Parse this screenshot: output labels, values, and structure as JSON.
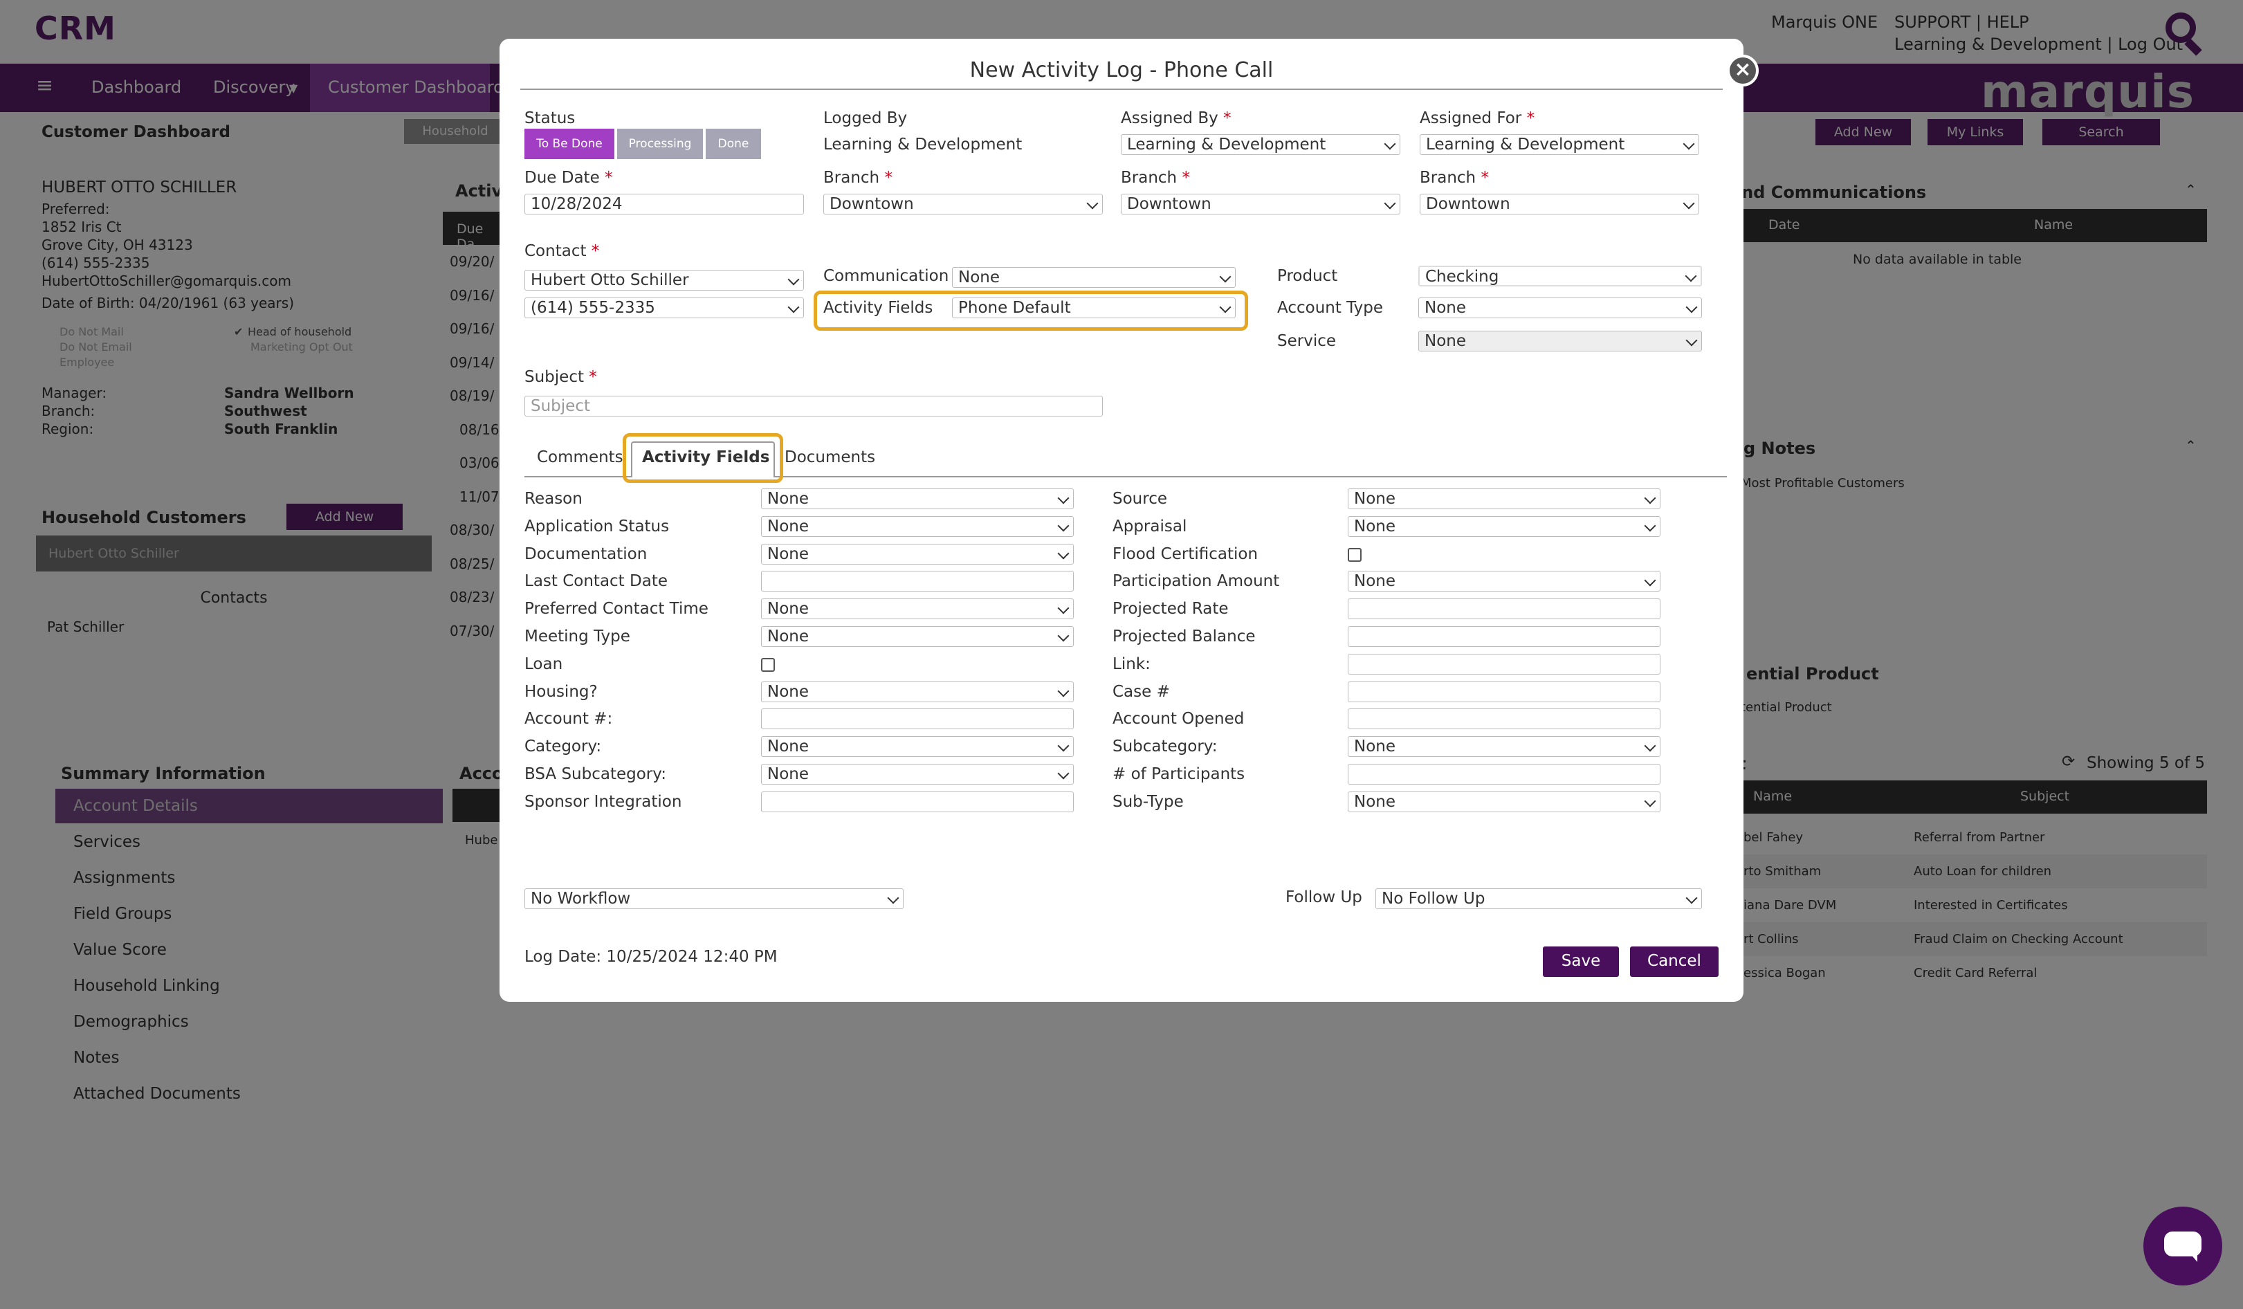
{
  "app": {
    "logo": "CRM",
    "brand": "marquis",
    "top_user": "Marquis ONE",
    "top_links_1": "SUPPORT  |  HELP",
    "top_links_2": "Learning & Development  |  Log Out"
  },
  "nav": {
    "menu_icon": "hamburger-icon",
    "items": [
      "Dashboard",
      "Discovery",
      "Customer Dashboard"
    ],
    "right_buttons": [
      "Add New",
      "My Links",
      "Search"
    ]
  },
  "background": {
    "page_title": "Customer Dashboard",
    "household_btn": "Household",
    "customer": {
      "name": "HUBERT OTTO SCHILLER",
      "preferred": "Preferred:",
      "address1": "1852 Iris Ct",
      "address2": "Grove City, OH 43123",
      "phone": "(614) 555-2335",
      "email": "HubertOttoSchiller@gomarquis.com",
      "dob": "Date of Birth: 04/20/1961 (63 years)",
      "flags_left": [
        "Do Not Mail",
        "Do Not Email",
        "Employee"
      ],
      "flags_right": [
        "Head of household",
        "Marketing Opt Out"
      ],
      "manager_label": "Manager:",
      "manager": "Sandra Wellborn",
      "branch_label": "Branch:",
      "branch": "Southwest",
      "region_label": "Region:",
      "region": "South Franklin"
    },
    "household": {
      "title": "Household Customers",
      "add_new": "Add New",
      "member": "Hubert Otto Schiller",
      "contacts_label": "Contacts",
      "contact": "Pat Schiller"
    },
    "summary": {
      "title": "Summary Information",
      "items": [
        "Account Details",
        "Services",
        "Assignments",
        "Field Groups",
        "Value Score",
        "Household Linking",
        "Demographics",
        "Notes",
        "Attached Documents"
      ]
    },
    "activity": {
      "title": "Activi",
      "col": "Due Da",
      "dates": [
        "09/20/",
        "09/16/",
        "09/16/",
        "09/14/",
        "08/19/",
        "08/16/",
        "03/06/",
        "11/07/",
        "08/30/",
        "08/25/",
        "08/23/",
        "07/30/"
      ]
    },
    "account": {
      "title": "Acco",
      "row": "Hube"
    },
    "right": {
      "comm_title": "und Communications",
      "comm_cols": [
        "Date",
        "Name"
      ],
      "comm_empty": "No data available in table",
      "notes_title": "g Notes",
      "notes_item": "Most Profitable Customers",
      "potential_title": "ential Product",
      "potential_item": "tential Product",
      "t_title": "t",
      "showing": "Showing 5 of 5",
      "list_cols": [
        "Name",
        "Subject"
      ],
      "rows": [
        {
          "name": "bel Fahey",
          "subject": "Referral from Partner"
        },
        {
          "name": "rto Smitham",
          "subject": "Auto Loan for children"
        },
        {
          "name": "iana Dare DVM",
          "subject": "Interested in Certificates"
        },
        {
          "name": "rt Collins",
          "subject": "Fraud Claim on Checking Account"
        },
        {
          "name": "essica Bogan",
          "subject": "Credit Card Referral"
        }
      ]
    }
  },
  "modal": {
    "title": "New Activity Log - Phone Call",
    "status_label": "Status",
    "status_buttons": [
      "To Be Done",
      "Processing",
      "Done"
    ],
    "logged_by_label": "Logged By",
    "logged_by": "Learning & Development",
    "assigned_by_label": "Assigned By",
    "assigned_by": "Learning & Development",
    "assigned_for_label": "Assigned For",
    "assigned_for": "Learning & Development",
    "due_date_label": "Due Date",
    "due_date": "10/28/2024",
    "branch_label": "Branch",
    "branch1": "Downtown",
    "branch2": "Downtown",
    "branch3": "Downtown",
    "contact_label": "Contact",
    "contact_name": "Hubert Otto Schiller",
    "contact_phone": "(614) 555-2335",
    "communication_label": "Communication",
    "communication": "None",
    "activity_fields_label": "Activity Fields",
    "activity_fields": "Phone Default",
    "product_label": "Product",
    "product": "Checking",
    "account_type_label": "Account Type",
    "account_type": "None",
    "service_label": "Service",
    "service": "None",
    "subject_label": "Subject",
    "subject_placeholder": "Subject",
    "tabs": [
      "Comments",
      "Activity Fields",
      "Documents"
    ],
    "left_fields": [
      {
        "label": "Reason",
        "value": "None"
      },
      {
        "label": "Application Status",
        "value": "None"
      },
      {
        "label": "Documentation",
        "value": "None"
      },
      {
        "label": "Last Contact Date",
        "value": ""
      },
      {
        "label": "Preferred Contact Time",
        "value": "None"
      },
      {
        "label": "Meeting Type",
        "value": "None"
      },
      {
        "label": "Loan",
        "value": ""
      },
      {
        "label": "Housing?",
        "value": "None"
      },
      {
        "label": "Account #:",
        "value": ""
      },
      {
        "label": "Category:",
        "value": "None"
      },
      {
        "label": "BSA Subcategory:",
        "value": "None"
      },
      {
        "label": "Sponsor Integration",
        "value": ""
      }
    ],
    "right_fields": [
      {
        "label": "Source",
        "value": "None"
      },
      {
        "label": "Appraisal",
        "value": "None"
      },
      {
        "label": "Flood Certification",
        "value": ""
      },
      {
        "label": "Participation Amount",
        "value": "None"
      },
      {
        "label": "Projected Rate",
        "value": ""
      },
      {
        "label": "Projected Balance",
        "value": ""
      },
      {
        "label": "Link:",
        "value": ""
      },
      {
        "label": "Case #",
        "value": ""
      },
      {
        "label": "Account Opened",
        "value": ""
      },
      {
        "label": "Subcategory:",
        "value": "None"
      },
      {
        "label": "# of Participants",
        "value": ""
      },
      {
        "label": "Sub-Type",
        "value": "None"
      }
    ],
    "workflow": "No Workflow",
    "follow_up_label": "Follow Up",
    "follow_up": "No Follow Up",
    "log_date": "Log Date: 10/25/2024 12:40 PM",
    "save": "Save",
    "cancel": "Cancel"
  },
  "colors": {
    "primary": "#5a1e6b",
    "status_active": "#a13ec4",
    "status_inactive": "#a5a5b5",
    "highlight": "#e6a723"
  }
}
